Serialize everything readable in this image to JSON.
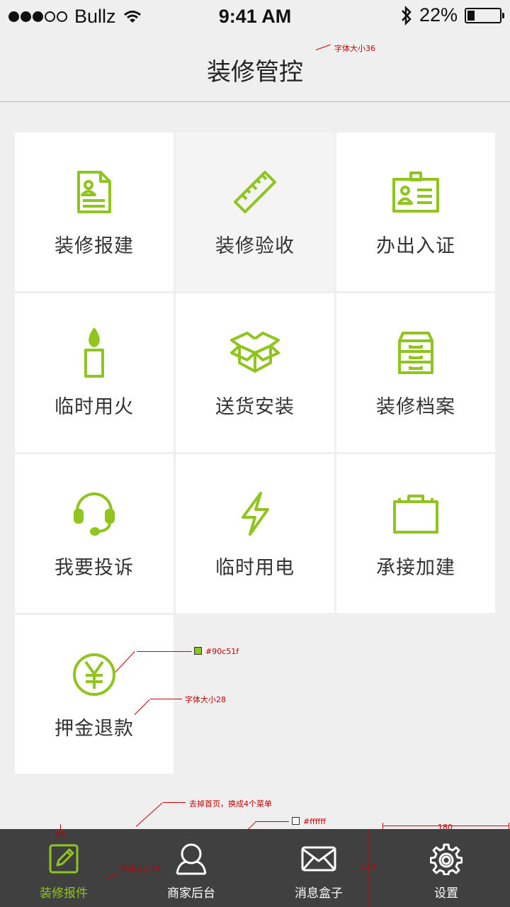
{
  "status_bar": {
    "carrier": "Bullz",
    "time": "9:41 AM",
    "battery": "22%",
    "battery_level": 0.22
  },
  "header": {
    "title": "装修管控"
  },
  "theme": {
    "accent": "#90c51f",
    "tab_bar_bg": "#404040",
    "tab_label": "#ffffff"
  },
  "grid": {
    "items": [
      {
        "label": "装修报建",
        "icon": "document-user-icon"
      },
      {
        "label": "装修验收",
        "icon": "ruler-icon"
      },
      {
        "label": "办出入证",
        "icon": "id-badge-icon"
      },
      {
        "label": "临时用火",
        "icon": "candle-icon"
      },
      {
        "label": "送货安装",
        "icon": "open-box-icon"
      },
      {
        "label": "装修档案",
        "icon": "file-cabinet-icon"
      },
      {
        "label": "我要投诉",
        "icon": "headset-icon"
      },
      {
        "label": "临时用电",
        "icon": "lightning-icon"
      },
      {
        "label": "承接加建",
        "icon": "briefcase-icon"
      },
      {
        "label": "押金退款",
        "icon": "yen-coin-icon"
      }
    ]
  },
  "annotations": {
    "title_font": "字体大小36",
    "icon_color": "#90c51f",
    "label_font": "字体大小28",
    "menu_note": "去掉首页，换成4个菜单",
    "tab_color": "#ffffff",
    "tab_font": "字体大小18",
    "tab_padding": "20",
    "tab_width": "180",
    "tab_height": "110"
  },
  "tab_bar": {
    "tabs": [
      {
        "label": "装修报件",
        "icon": "edit-icon",
        "active": true
      },
      {
        "label": "商家后台",
        "icon": "user-icon",
        "active": false
      },
      {
        "label": "消息盒子",
        "icon": "mail-icon",
        "active": false
      },
      {
        "label": "设置",
        "icon": "gear-icon",
        "active": false
      }
    ]
  }
}
